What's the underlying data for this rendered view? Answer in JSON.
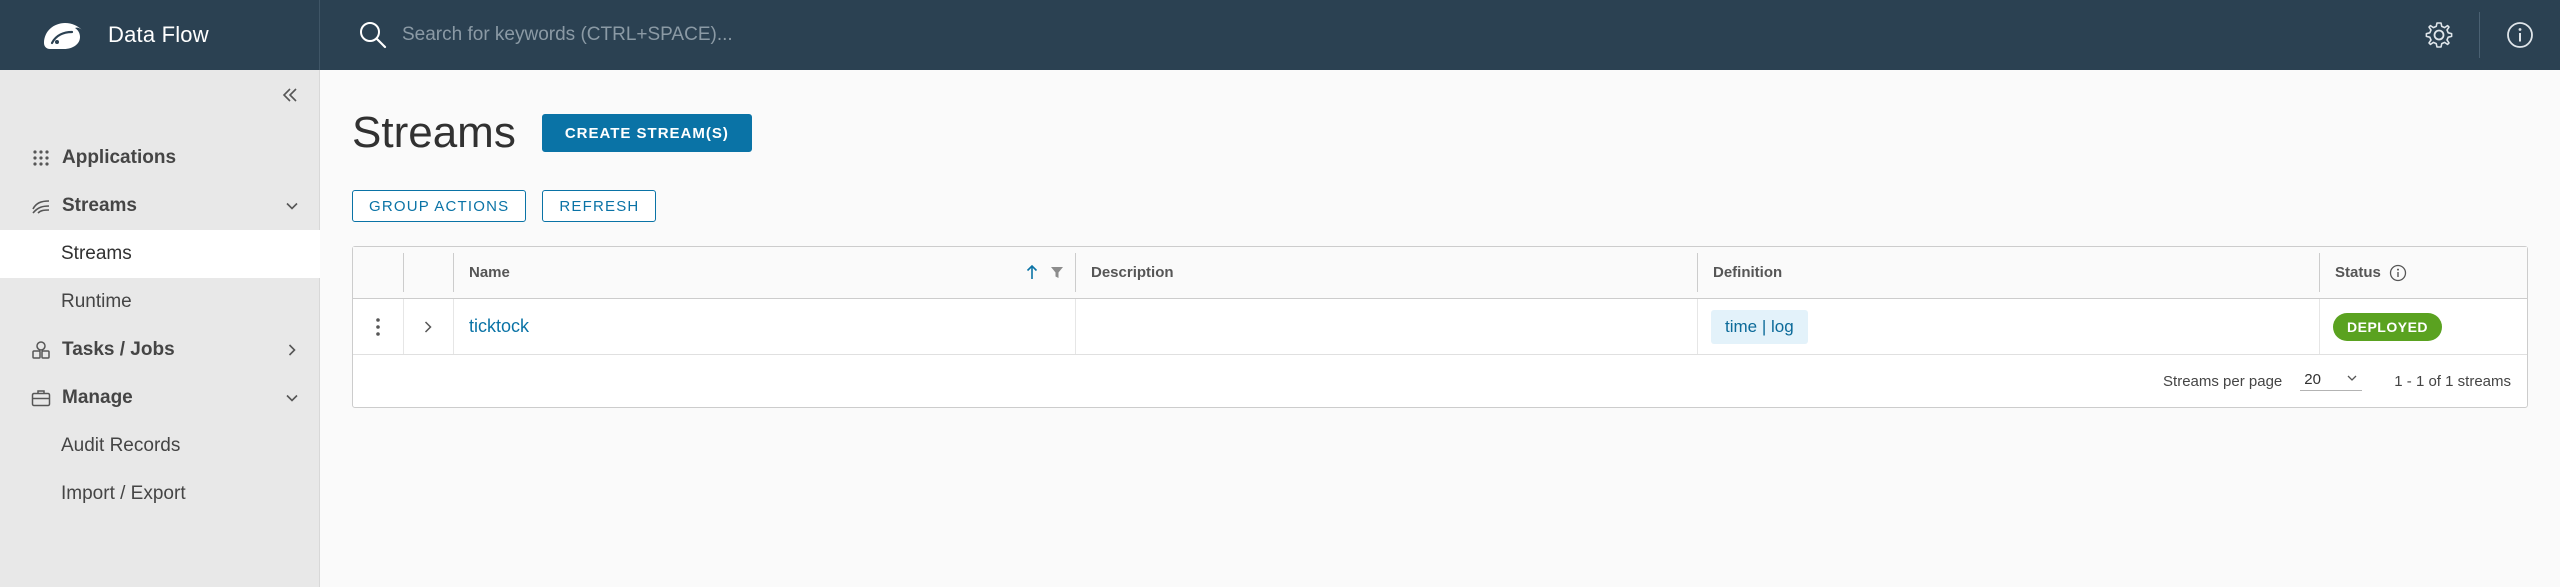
{
  "app": {
    "name": "Data Flow"
  },
  "search": {
    "placeholder": "Search for keywords (CTRL+SPACE)..."
  },
  "sidebar": {
    "items": [
      {
        "label": "Applications"
      },
      {
        "label": "Streams",
        "children": [
          {
            "label": "Streams",
            "active": true
          },
          {
            "label": "Runtime"
          }
        ]
      },
      {
        "label": "Tasks / Jobs"
      },
      {
        "label": "Manage",
        "children": [
          {
            "label": "Audit Records"
          },
          {
            "label": "Import / Export"
          }
        ]
      }
    ]
  },
  "page": {
    "title": "Streams",
    "create_label": "CREATE STREAM(S)",
    "group_actions_label": "GROUP ACTIONS",
    "refresh_label": "REFRESH"
  },
  "table": {
    "columns": {
      "name": "Name",
      "description": "Description",
      "definition": "Definition",
      "status": "Status"
    },
    "rows": [
      {
        "name": "ticktock",
        "description": "",
        "definition": "time | log",
        "status": "DEPLOYED"
      }
    ],
    "footer": {
      "per_page_label": "Streams per page",
      "per_page_value": "20",
      "range": "1 - 1 of 1 streams"
    }
  },
  "colors": {
    "header_bg": "#2b4152",
    "accent": "#0a73a6",
    "deployed": "#5aa220"
  }
}
